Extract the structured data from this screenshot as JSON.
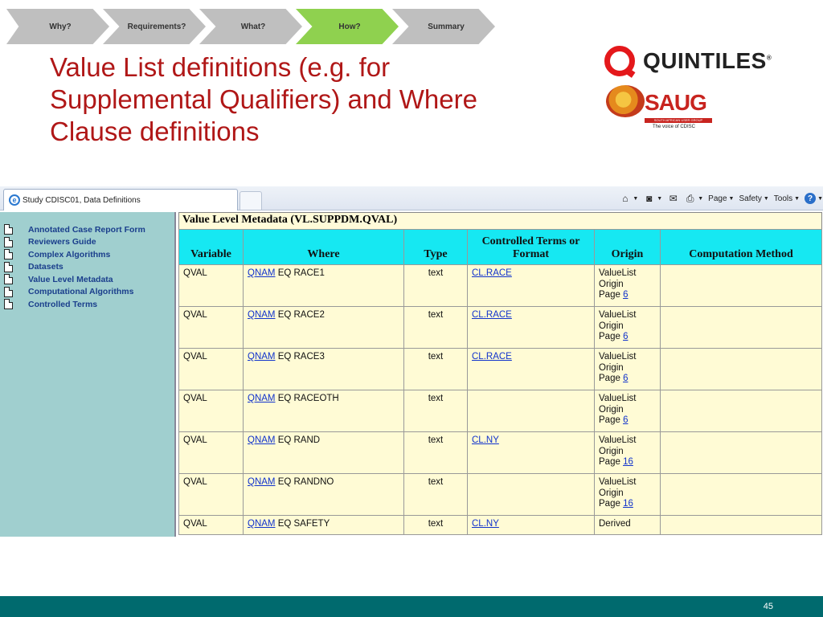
{
  "breadcrumb": {
    "steps": [
      {
        "label": "Why?",
        "active": false
      },
      {
        "label": "Requirements?",
        "active": false
      },
      {
        "label": "What?",
        "active": false
      },
      {
        "label": "How?",
        "active": true
      },
      {
        "label": "Summary",
        "active": false
      }
    ],
    "colors": {
      "inactive": "#bfbfbf",
      "active": "#8fd14f"
    }
  },
  "slide": {
    "title_line1": "Value List definitions (e.g. for",
    "title_line2": "Supplemental Qualifiers) and Where",
    "title_line3": "Clause definitions",
    "title_color": "#b01717",
    "page_number": "45"
  },
  "logos": {
    "quintiles": "QUINTILES",
    "quintiles_mark": "®",
    "saug": "SAUG",
    "saug_band": "SOUTH AFRICAN USER GROUP",
    "saug_tagline": "The voice of CDISC"
  },
  "browser": {
    "tab_title": "Study CDISC01, Data Definitions",
    "tab_icon": "ie-icon",
    "commands": {
      "home_icon": "⌂",
      "feeds_icon": "◙",
      "mail_icon": "✉",
      "print_icon": "⎙",
      "page": "Page",
      "safety": "Safety",
      "tools": "Tools",
      "help_icon": "?"
    }
  },
  "nav": {
    "items": [
      "Annotated Case Report Form",
      "Reviewers Guide",
      "Complex Algorithms",
      "Datasets",
      "Value Level Metadata",
      "Computational Algorithms",
      "Controlled Terms"
    ]
  },
  "table": {
    "caption": "Value Level Metadata (VL.SUPPDM.QVAL)",
    "headers": [
      "Variable",
      "Where",
      "Type",
      "Controlled Terms or Format",
      "Origin",
      "Computation Method"
    ],
    "rows": [
      {
        "variable": "QVAL",
        "where_link": "QNAM",
        "where_rest": " EQ RACE1",
        "type": "text",
        "terms": "CL.RACE",
        "origin_line1": "ValueList",
        "origin_line2": "Origin",
        "origin_page_label": "Page ",
        "origin_page": "6",
        "computation": ""
      },
      {
        "variable": "QVAL",
        "where_link": "QNAM",
        "where_rest": " EQ RACE2",
        "type": "text",
        "terms": "CL.RACE",
        "origin_line1": "ValueList",
        "origin_line2": "Origin",
        "origin_page_label": "Page ",
        "origin_page": "6",
        "computation": ""
      },
      {
        "variable": "QVAL",
        "where_link": "QNAM",
        "where_rest": " EQ RACE3",
        "type": "text",
        "terms": "CL.RACE",
        "origin_line1": "ValueList",
        "origin_line2": "Origin",
        "origin_page_label": "Page ",
        "origin_page": "6",
        "computation": ""
      },
      {
        "variable": "QVAL",
        "where_link": "QNAM",
        "where_rest": " EQ RACEOTH",
        "type": "text",
        "terms": "",
        "origin_line1": "ValueList",
        "origin_line2": "Origin",
        "origin_page_label": "Page ",
        "origin_page": "6",
        "computation": ""
      },
      {
        "variable": "QVAL",
        "where_link": "QNAM",
        "where_rest": " EQ RAND",
        "type": "text",
        "terms": "CL.NY",
        "origin_line1": "ValueList",
        "origin_line2": "Origin",
        "origin_page_label": "Page ",
        "origin_page": "16",
        "computation": ""
      },
      {
        "variable": "QVAL",
        "where_link": "QNAM",
        "where_rest": " EQ RANDNO",
        "type": "text",
        "terms": "",
        "origin_line1": "ValueList",
        "origin_line2": "Origin",
        "origin_page_label": "Page ",
        "origin_page": "16",
        "computation": ""
      },
      {
        "variable": "QVAL",
        "where_link": "QNAM",
        "where_rest": " EQ SAFETY",
        "type": "text",
        "terms": "CL.NY",
        "origin_line1": "Derived",
        "origin_line2": "",
        "origin_page_label": "",
        "origin_page": "",
        "computation": ""
      }
    ],
    "colors": {
      "header": "#16e8f2",
      "cell": "#fffbd5"
    }
  },
  "footer_color": "#006a6e"
}
